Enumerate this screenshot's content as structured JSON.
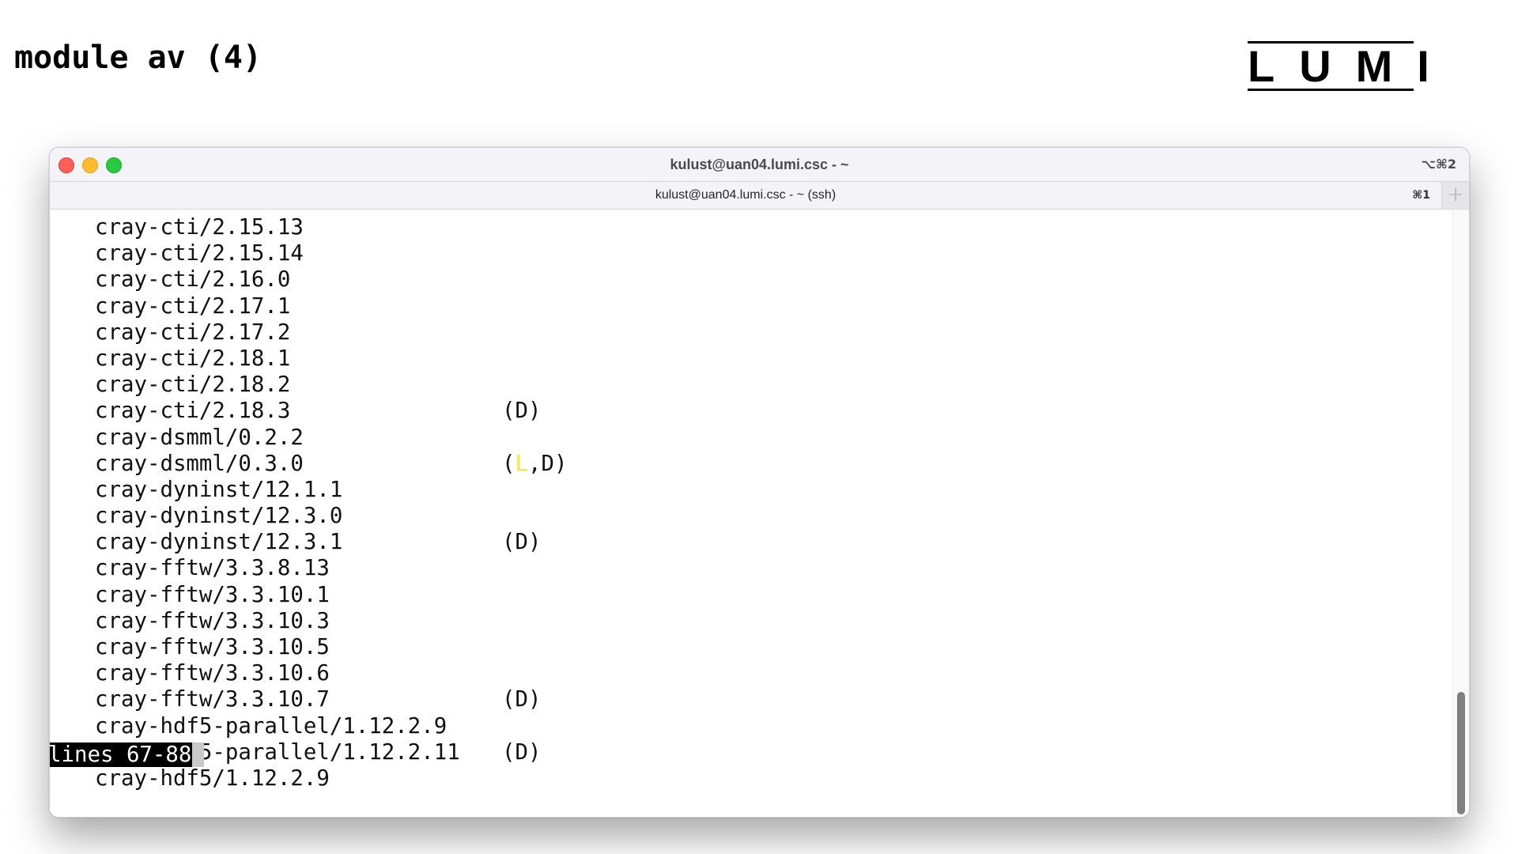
{
  "slide": {
    "title": "module av (4)",
    "logo_text": "LUMI"
  },
  "window": {
    "title": "kulust@uan04.lumi.csc - ~",
    "shortcut": "⌥⌘2",
    "traffic_lights": {
      "close_color": "#fe5f57",
      "minimize_color": "#febc2e",
      "maximize_color": "#28c840"
    }
  },
  "tabbar": {
    "tabs": [
      {
        "label": "kulust@uan04.lumi.csc - ~ (ssh)",
        "shortcut": "⌘1"
      }
    ],
    "new_tab_icon": "+"
  },
  "terminal": {
    "lines": [
      {
        "text": "cray-cti/2.15.13",
        "flag": ""
      },
      {
        "text": "cray-cti/2.15.14",
        "flag": ""
      },
      {
        "text": "cray-cti/2.16.0",
        "flag": ""
      },
      {
        "text": "cray-cti/2.17.1",
        "flag": ""
      },
      {
        "text": "cray-cti/2.17.2",
        "flag": ""
      },
      {
        "text": "cray-cti/2.18.1",
        "flag": ""
      },
      {
        "text": "cray-cti/2.18.2",
        "flag": ""
      },
      {
        "text": "cray-cti/2.18.3",
        "flag": "(D)"
      },
      {
        "text": "cray-dsmml/0.2.2",
        "flag": ""
      },
      {
        "text": "cray-dsmml/0.3.0",
        "flag_pre": "(",
        "flag_hl": "L",
        "flag_post": ",D)"
      },
      {
        "text": "cray-dyninst/12.1.1",
        "flag": ""
      },
      {
        "text": "cray-dyninst/12.3.0",
        "flag": ""
      },
      {
        "text": "cray-dyninst/12.3.1",
        "flag": "(D)"
      },
      {
        "text": "cray-fftw/3.3.8.13",
        "flag": ""
      },
      {
        "text": "cray-fftw/3.3.10.1",
        "flag": ""
      },
      {
        "text": "cray-fftw/3.3.10.3",
        "flag": ""
      },
      {
        "text": "cray-fftw/3.3.10.5",
        "flag": ""
      },
      {
        "text": "cray-fftw/3.3.10.6",
        "flag": ""
      },
      {
        "text": "cray-fftw/3.3.10.7",
        "flag": "(D)"
      },
      {
        "text": "cray-hdf5-parallel/1.12.2.9",
        "flag": ""
      },
      {
        "text": "cray-hdf5-parallel/1.12.2.11",
        "flag": "(D)"
      },
      {
        "text": "cray-hdf5/1.12.2.9",
        "flag": ""
      }
    ],
    "status": "lines 67-88",
    "highlight_color": "#f7e93a"
  }
}
